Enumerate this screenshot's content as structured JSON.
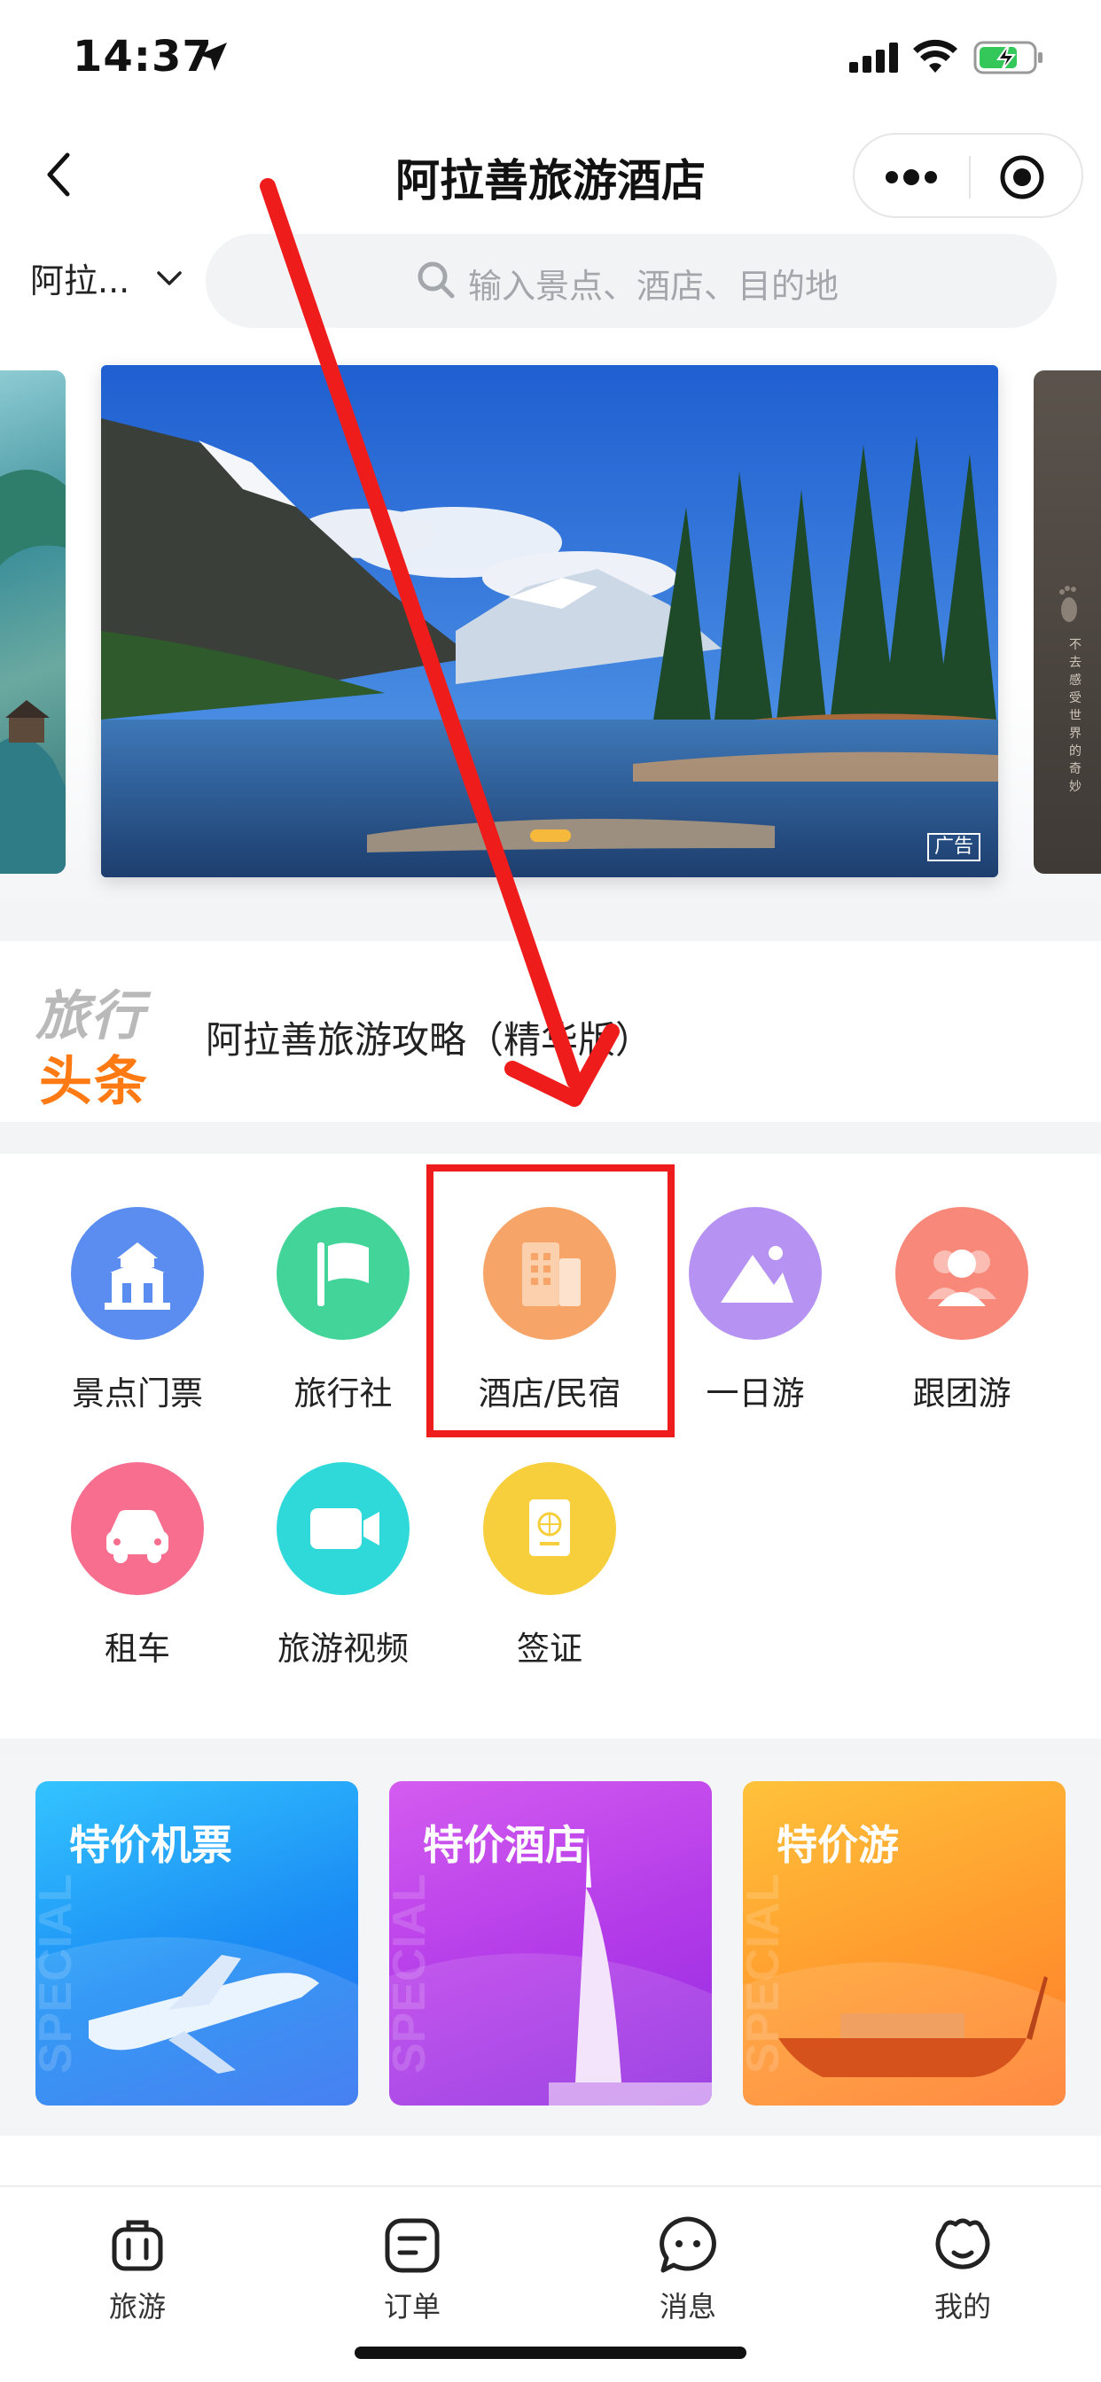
{
  "status_bar": {
    "time": "14:37"
  },
  "nav": {
    "title": "阿拉善旅游酒店"
  },
  "search": {
    "city": "阿拉...",
    "placeholder": "输入景点、酒店、目的地"
  },
  "banner": {
    "ad_label": "广告",
    "side_right_text": "不去感受世界的奇妙"
  },
  "news": {
    "logo_top": "旅行",
    "logo_bottom": "头条",
    "headline": "阿拉善旅游攻略（精华版）"
  },
  "grid": {
    "items": [
      {
        "label": "景点门票",
        "icon": "temple-icon",
        "color": "#5b8df0"
      },
      {
        "label": "旅行社",
        "icon": "flag-icon",
        "color": "#43d49a"
      },
      {
        "label": "酒店/民宿",
        "icon": "building-icon",
        "color": "#f7a468"
      },
      {
        "label": "一日游",
        "icon": "mountain-icon",
        "color": "#b693f2"
      },
      {
        "label": "跟团游",
        "icon": "group-icon",
        "color": "#f7887a"
      },
      {
        "label": "租车",
        "icon": "car-icon",
        "color": "#f76e8e"
      },
      {
        "label": "旅游视频",
        "icon": "video-camera-icon",
        "color": "#2fd9da"
      },
      {
        "label": "签证",
        "icon": "passport-icon",
        "color": "#f7cf3c"
      }
    ]
  },
  "promo": {
    "cards": [
      {
        "title": "特价机票",
        "watermark": "SPECIAL"
      },
      {
        "title": "特价酒店",
        "watermark": "SPECIAL"
      },
      {
        "title": "特价游",
        "watermark": "SPECIAL"
      }
    ]
  },
  "tabbar": {
    "items": [
      {
        "label": "旅游",
        "icon": "luggage-icon"
      },
      {
        "label": "订单",
        "icon": "order-list-icon"
      },
      {
        "label": "消息",
        "icon": "message-icon"
      },
      {
        "label": "我的",
        "icon": "profile-icon"
      }
    ]
  }
}
